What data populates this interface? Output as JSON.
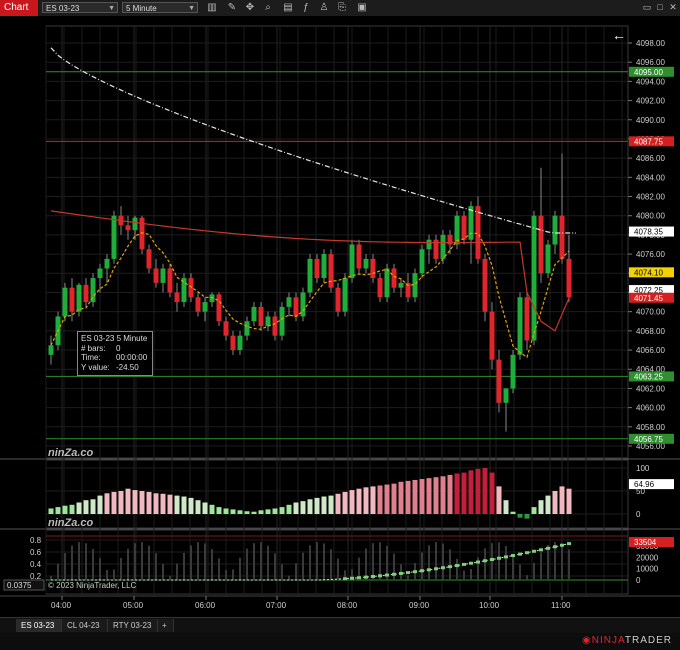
{
  "toolbar": {
    "title": "Chart",
    "instrument": "ES 03-23",
    "interval": "5 Minute",
    "icons": [
      "bar-style-icon",
      "drawing-tools-icon",
      "crosshair-icon",
      "zoom-icon",
      "properties-icon",
      "indicators-icon",
      "strategies-icon",
      "templates-icon",
      "workspace-icon",
      "maximize-icon",
      "close-icon"
    ]
  },
  "price_axis": {
    "ticks": [
      "4098.00",
      "4096.00",
      "4094.00",
      "4092.00",
      "4090.00",
      "4088.00",
      "4086.00",
      "4084.00",
      "4082.00",
      "4080.00",
      "4078.00",
      "4076.00",
      "4074.00",
      "4072.00",
      "4070.00",
      "4068.00",
      "4066.00",
      "4064.00",
      "4062.00",
      "4060.00",
      "4058.00",
      "4056.00"
    ],
    "markers": [
      {
        "label": "4095.00",
        "color": "#2f8f2f"
      },
      {
        "label": "4087.75",
        "color": "#d42020"
      },
      {
        "label": "4078.35",
        "color": "#ffffff"
      },
      {
        "label": "4074.10",
        "color": "#f2d200"
      },
      {
        "label": "4072.25",
        "color": "#ffffff"
      },
      {
        "label": "4071.45",
        "color": "#d42020"
      },
      {
        "label": "4063.25",
        "color": "#2f8f2f"
      },
      {
        "label": "4056.75",
        "color": "#2f8f2f"
      }
    ]
  },
  "osc_axis": {
    "ticks": [
      "100",
      "50",
      "0"
    ],
    "marker": "64.96"
  },
  "vol_axis": {
    "ticks": [
      "30000",
      "20000",
      "10000",
      "0"
    ],
    "marker": "33504",
    "left_ticks": [
      "0.8",
      "0.6",
      "0.4",
      "0.2"
    ]
  },
  "time_axis": [
    "04:00",
    "05:00",
    "06:00",
    "07:00",
    "08:00",
    "09:00",
    "10:00",
    "11:00"
  ],
  "watermark": "ninZa.co",
  "copyright": "© 2023 NinjaTrader, LLC",
  "left_value": "0.0375",
  "back_arrow": "←",
  "info": {
    "title": "ES 03-23 5 Minute",
    "rows": [
      {
        "k": "# bars:",
        "v": "0"
      },
      {
        "k": "Time:",
        "v": "00:00:00"
      },
      {
        "k": "Y value:",
        "v": "-24.50"
      }
    ]
  },
  "tabs": [
    {
      "label": "ES 03-23",
      "active": true
    },
    {
      "label": "CL 04-23",
      "active": false
    },
    {
      "label": "RTY 03-23",
      "active": false
    }
  ],
  "add_tab": "+",
  "brand": {
    "prefix": "NINJA",
    "suffix": "TRADER"
  },
  "colors": {
    "up": "#1fae3b",
    "down": "#e0262c",
    "accent": "#c8171d"
  }
}
